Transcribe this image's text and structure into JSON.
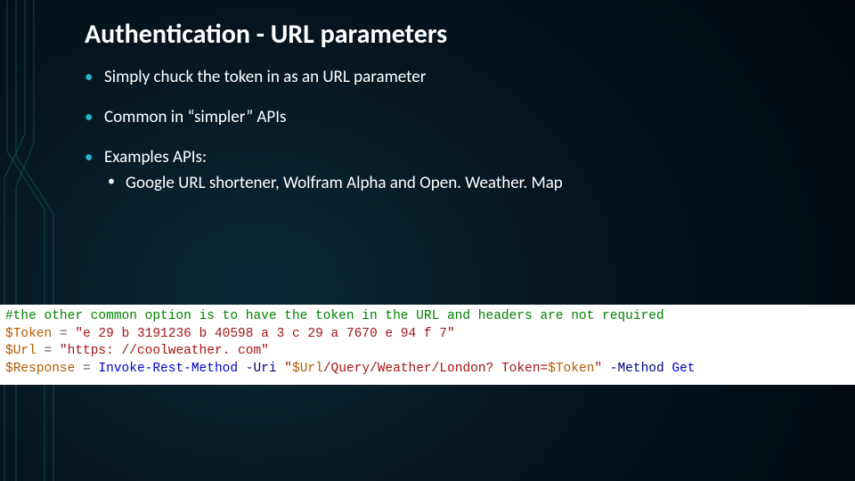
{
  "title": "Authentication - URL parameters",
  "bullets": {
    "b1": "Simply chuck the token in as an URL parameter",
    "b2": "Common in “simpler” APIs",
    "b3": "Examples APIs:",
    "b3_sub1": "Google URL shortener,  Wolfram Alpha and Open. Weather. Map"
  },
  "code": {
    "comment": "#the other common option is to have the token in the URL and headers are not required",
    "var_token": "$Token",
    "var_url": "$Url",
    "var_response": "$Response",
    "eq": " = ",
    "token_value": "\"e 29 b 3191236 b 40598 a 3 c 29 a 7670 e 94 f 7\"",
    "url_value": "\"https: //coolweather. com\"",
    "cmd": "Invoke-Rest-Method",
    "p_uri": " -Uri ",
    "uri_left": "\"",
    "uri_path": "/Query/Weather/London? Token=",
    "uri_right": "\"",
    "p_method": " -Method ",
    "method_val": "Get"
  }
}
